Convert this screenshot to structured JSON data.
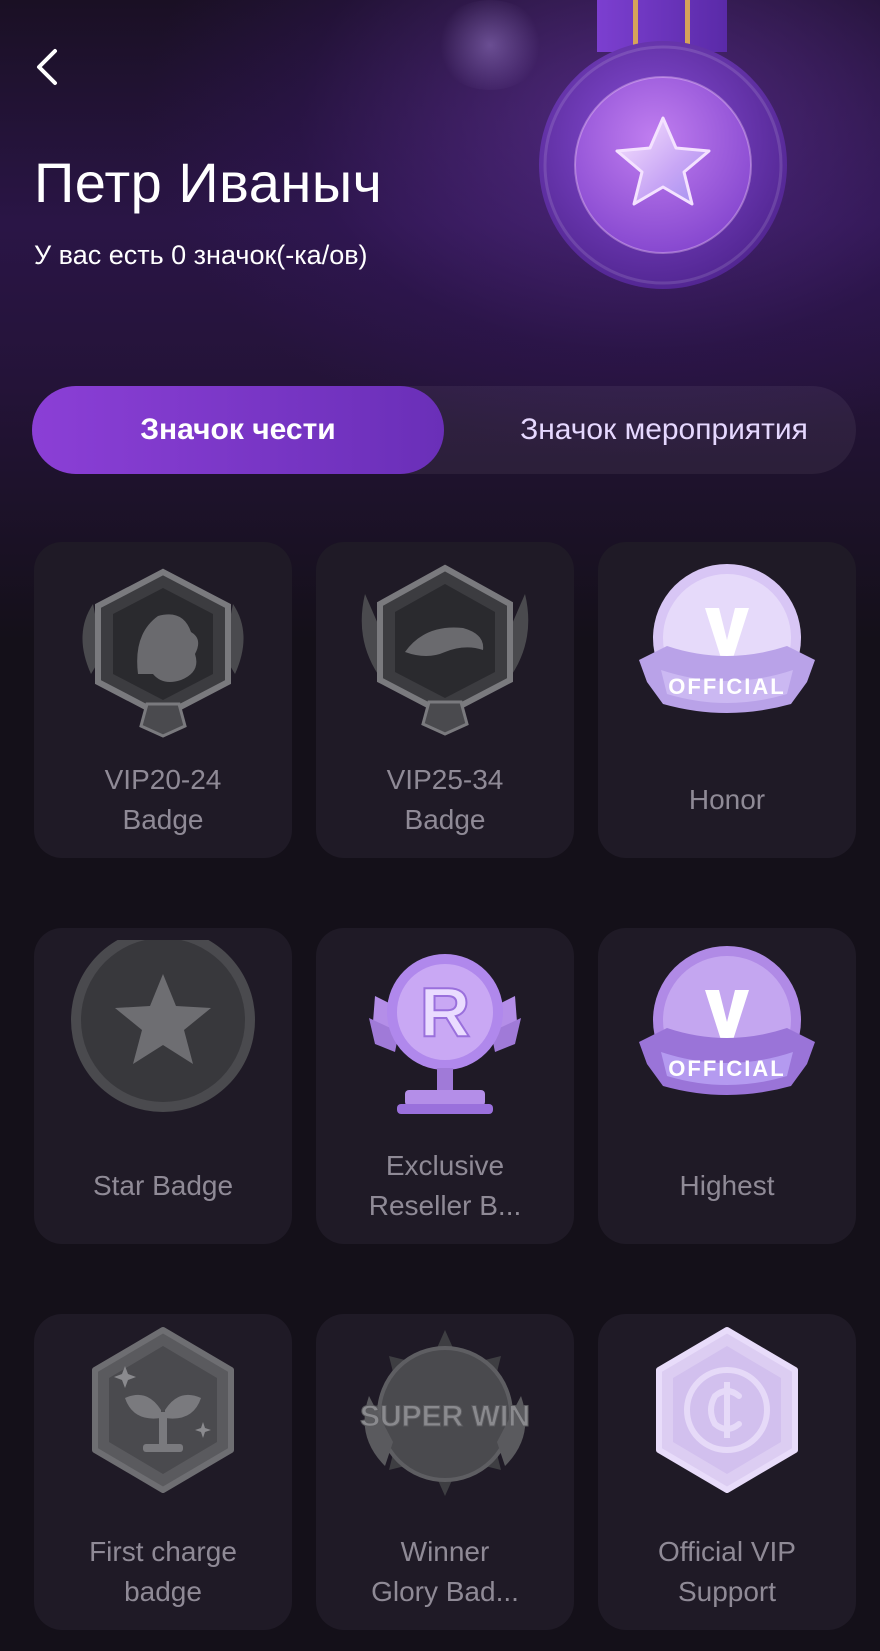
{
  "header": {
    "name": "Петр Иваныч",
    "badge_count_text": "У вас есть 0 значок(-ка/ов)"
  },
  "tabs": [
    {
      "label": "Значок чести",
      "active": true
    },
    {
      "label": "Значок мероприятия",
      "active": false
    }
  ],
  "badges": [
    {
      "label_line1": "VIP20-24",
      "label_line2": "Badge",
      "icon": "lion-shield-icon",
      "unlocked": false
    },
    {
      "label_line1": "VIP25-34",
      "label_line2": "Badge",
      "icon": "panther-shield-icon",
      "unlocked": false
    },
    {
      "label_line1": "Honor",
      "label_line2": "",
      "icon": "official-v-icon",
      "unlocked": false
    },
    {
      "label_line1": "Star Badge",
      "label_line2": "",
      "icon": "star-medal-icon",
      "unlocked": false
    },
    {
      "label_line1": "Exclusive",
      "label_line2": "Reseller B...",
      "icon": "reseller-trophy-icon",
      "unlocked": false
    },
    {
      "label_line1": "Highest",
      "label_line2": "",
      "icon": "official-v-icon",
      "unlocked": false
    },
    {
      "label_line1": "First charge",
      "label_line2": "badge",
      "icon": "sprout-hexagon-icon",
      "unlocked": false
    },
    {
      "label_line1": "Winner",
      "label_line2": "Glory Bad...",
      "icon": "super-win-icon",
      "unlocked": false
    },
    {
      "label_line1": "Official VIP",
      "label_line2": "Support",
      "icon": "coin-hexagon-icon",
      "unlocked": false
    }
  ],
  "official_ribbon_text": "OFFICIAL",
  "super_win_text": "SUPER WIN",
  "colors": {
    "accent": "#8b3fd6",
    "card_bg": "#1f1a26",
    "label_muted": "#8f8a96",
    "lavender": "#c9b4f0"
  }
}
